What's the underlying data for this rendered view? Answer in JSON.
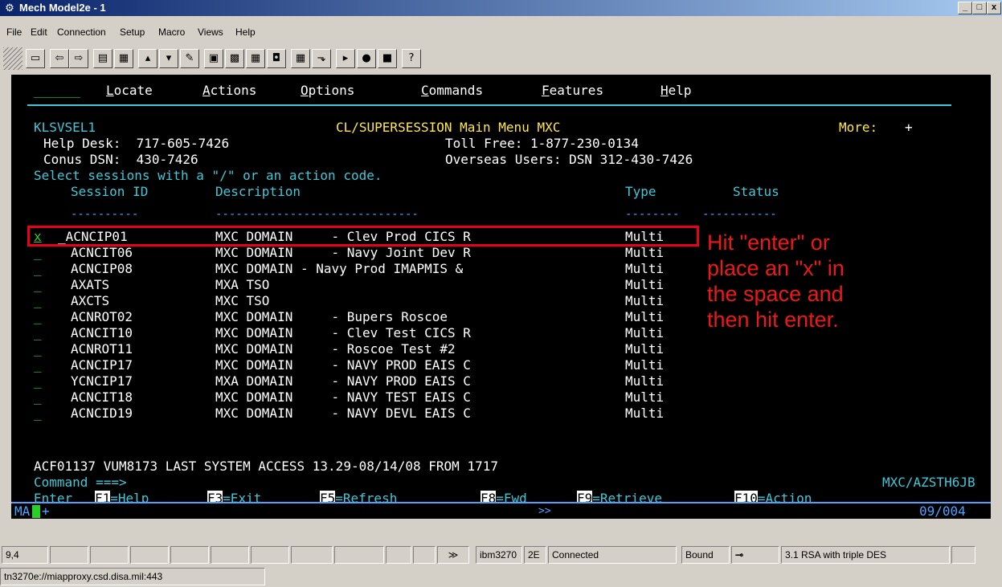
{
  "window": {
    "title": "Mech Model2e - 1",
    "min": "_",
    "max": "□",
    "close": "x"
  },
  "menu": [
    "File",
    "Edit",
    "Connection",
    "Setup",
    "Macro",
    "Views",
    "Help"
  ],
  "toolbar_icons": [
    "window-icon",
    "back-icon",
    "forward-icon",
    "save-icon",
    "print-icon",
    "send-icon",
    "receive-icon",
    "transfer-icon",
    "screen-icon",
    "keypad-icon",
    "calc-icon",
    "mouse-icon",
    "grid-icon",
    "chart-icon",
    "play-icon",
    "record-icon",
    "stop-icon",
    "help-icon"
  ],
  "terminal": {
    "actionbar": {
      "blank": "_____",
      "items": [
        "Locate",
        "Actions",
        "Options",
        "Commands",
        "Features",
        "Help"
      ]
    },
    "screen_id": "KLSVSEL1",
    "screen_title": "CL/SUPERSESSION Main Menu MXC",
    "more_label": "More:",
    "more_sign": "+",
    "help_desk": "Help Desk:  717-605-7426",
    "toll_free": "Toll Free: 1-877-230-0134",
    "conus": "Conus DSN:  430-7426",
    "overseas": "Overseas Users: DSN 312-430-7426",
    "instruction": "Select sessions with a \"/\" or an action code.",
    "columns": {
      "session_id": "Session ID",
      "description": "Description",
      "type": "Type",
      "status": "Status"
    },
    "dashes": {
      "session_id": "----------",
      "description": "------------------------------",
      "type": "--------",
      "status": "-----------"
    },
    "sessions": [
      {
        "sel": "x",
        "id": "_ACNCIP01",
        "desc": "MXC DOMAIN     - Clev Prod CICS R",
        "type": "Multi"
      },
      {
        "sel": "_",
        "id": "ACNCIT06",
        "desc": "MXC DOMAIN     - Navy Joint Dev R",
        "type": "Multi"
      },
      {
        "sel": "_",
        "id": "ACNCIP08",
        "desc": "MXC DOMAIN - Navy Prod IMAPMIS &",
        "type": "Multi"
      },
      {
        "sel": "_",
        "id": "AXATS",
        "desc": "MXA TSO",
        "type": "Multi"
      },
      {
        "sel": "_",
        "id": "AXCTS",
        "desc": "MXC TSO",
        "type": "Multi"
      },
      {
        "sel": "_",
        "id": "ACNROT02",
        "desc": "MXC DOMAIN     - Bupers Roscoe",
        "type": "Multi"
      },
      {
        "sel": "_",
        "id": "ACNCIT10",
        "desc": "MXC DOMAIN     - Clev Test CICS R",
        "type": "Multi"
      },
      {
        "sel": "_",
        "id": "ACNROT11",
        "desc": "MXC DOMAIN     - Roscoe Test #2",
        "type": "Multi"
      },
      {
        "sel": "_",
        "id": "ACNCIP17",
        "desc": "MXC DOMAIN     - NAVY PROD EAIS C",
        "type": "Multi"
      },
      {
        "sel": "_",
        "id": "YCNCIP17",
        "desc": "MXA DOMAIN     - NAVY PROD EAIS C",
        "type": "Multi"
      },
      {
        "sel": "_",
        "id": "ACNCIT18",
        "desc": "MXC DOMAIN     - NAVY TEST EAIS C",
        "type": "Multi"
      },
      {
        "sel": "_",
        "id": "ACNCID19",
        "desc": "MXC DOMAIN     - NAVY DEVL EAIS C",
        "type": "Multi"
      }
    ],
    "access_msg": "ACF01137 VUM8173 LAST SYSTEM ACCESS 13.29-08/14/08 FROM 1717",
    "command_label": "Command ===>",
    "userid": "MXC/AZSTH6JB",
    "enter_label": "Enter",
    "fkeys": [
      {
        "key": "F1",
        "label": "=Help"
      },
      {
        "key": "F3",
        "label": "=Exit"
      },
      {
        "key": "F5",
        "label": "=Refresh"
      },
      {
        "key": "F8",
        "label": "=Fwd"
      },
      {
        "key": "F9",
        "label": "=Retrieve"
      },
      {
        "key": "F10",
        "label": "=Action"
      }
    ],
    "oia_left": "MA",
    "oia_plus": "+",
    "oia_mid": ">>",
    "oia_right": "09/004"
  },
  "annotation": "Hit \"enter\" or\nplace an \"x\" in\nthe space and\nthen hit enter.",
  "statusbar": {
    "cursor": "9,4",
    "arrows": "≫",
    "terminal_type": "ibm3270",
    "model": "2E",
    "connection": "Connected",
    "bound": "Bound",
    "key_icon": "key-icon",
    "encryption": "3.1 RSA with triple DES",
    "url": "tn3270e://miapproxy.csd.disa.mil:443"
  },
  "colors": {
    "terminal_bg": "#000000",
    "annotation_red": "#ee1818",
    "box_red": "#e8001c",
    "green": "#28d028",
    "yellow": "#ffe84a",
    "cyan": "#40c8d8",
    "blue": "#4aa3ff"
  }
}
